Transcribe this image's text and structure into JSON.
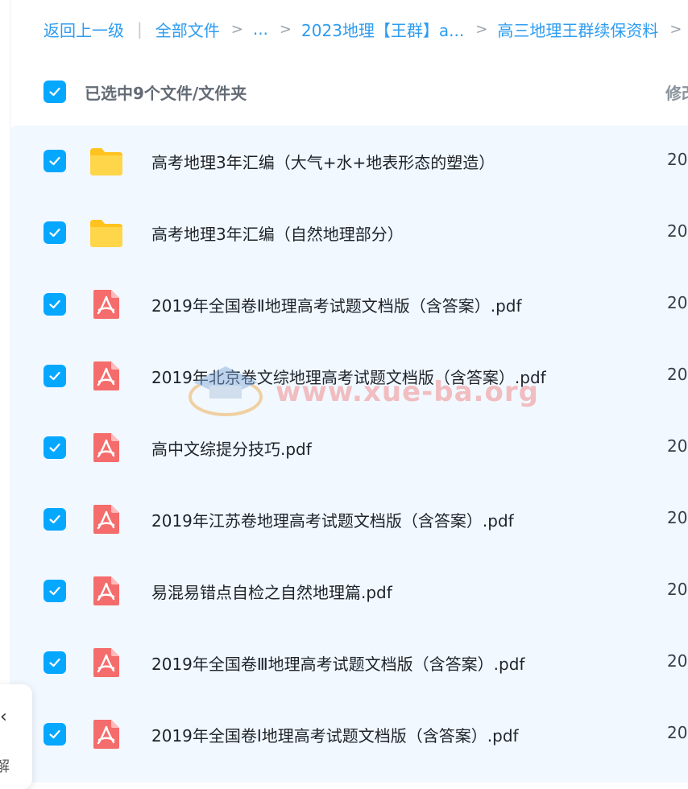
{
  "breadcrumb": {
    "back": "返回上一级",
    "sep_bar": "|",
    "sep": ">",
    "items": [
      "全部文件",
      "...",
      "2023地理【王群】a...",
      "高三地理王群续保资料"
    ]
  },
  "header": {
    "selected_text": "已选中9个文件/文件夹",
    "modified_col": "修改"
  },
  "files": [
    {
      "name": "高考地理3年汇编（大气+水+地表形态的塑造）",
      "type": "folder",
      "date": "20"
    },
    {
      "name": "高考地理3年汇编（自然地理部分）",
      "type": "folder",
      "date": "20"
    },
    {
      "name": "2019年全国卷Ⅱ地理高考试题文档版（含答案）.pdf",
      "type": "pdf",
      "date": "20"
    },
    {
      "name": "2019年北京卷文综地理高考试题文档版（含答案）.pdf",
      "type": "pdf",
      "date": "20"
    },
    {
      "name": "高中文综提分技巧.pdf",
      "type": "pdf",
      "date": "20"
    },
    {
      "name": "2019年江苏卷地理高考试题文档版（含答案）.pdf",
      "type": "pdf",
      "date": "20"
    },
    {
      "name": "易混易错点自检之自然地理篇.pdf",
      "type": "pdf",
      "date": "20"
    },
    {
      "name": "2019年全国卷Ⅲ地理高考试题文档版（含答案）.pdf",
      "type": "pdf",
      "date": "20"
    },
    {
      "name": "2019年全国卷Ⅰ地理高考试题文档版（含答案）.pdf",
      "type": "pdf",
      "date": "20"
    }
  ],
  "watermark": "www.xue-ba.org",
  "float_panel": {
    "chevron": "‹",
    "text": "解"
  },
  "colors": {
    "accent": "#06a7ff",
    "list_bg": "#f1f8ff",
    "folder": "#ffcc33",
    "pdf": "#f56c6c"
  }
}
